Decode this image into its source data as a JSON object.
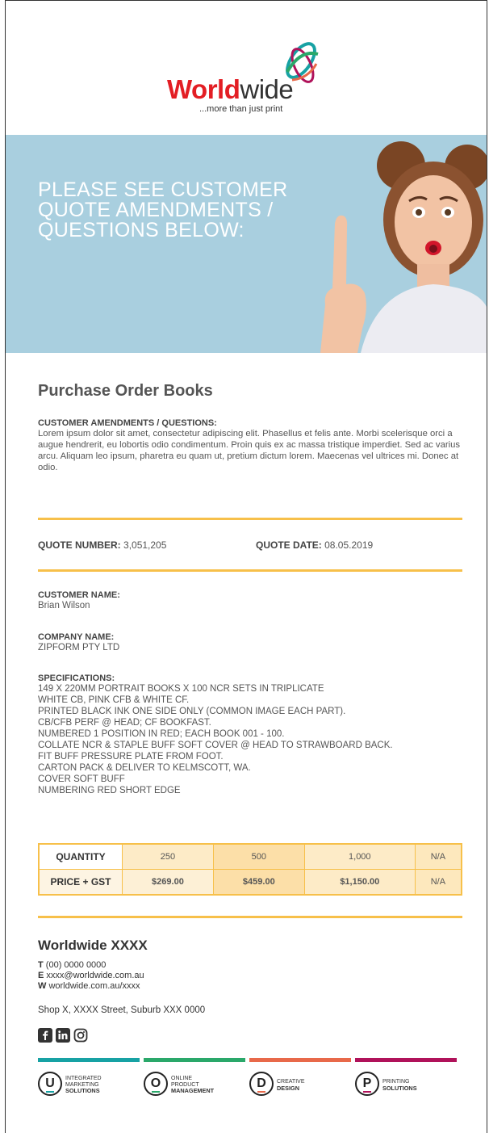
{
  "brand": {
    "name_bold": "World",
    "name_thin": "wide",
    "tagline": "...more than just print",
    "colors": {
      "red": "#e31e24",
      "teal": "#17a2a4",
      "green": "#2aa86a",
      "orange": "#e8694a",
      "magenta": "#b0125a",
      "accent_yellow": "#f7c04a",
      "hero_blue": "#a9cfdf"
    }
  },
  "hero": {
    "headline": "PLEASE SEE CUSTOMER QUOTE AMENDMENTS / QUESTIONS BELOW:"
  },
  "document": {
    "title": "Purchase Order Books",
    "amendments_label": "CUSTOMER AMENDMENTS / QUESTIONS:",
    "amendments_text": "Lorem ipsum dolor sit amet, consectetur adipiscing elit. Phasellus et felis ante. Morbi scelerisque orci a augue hendrerit, eu lobortis odio condimentum. Proin quis ex ac massa tristique imperdiet. Sed ac varius arcu. Aliquam leo ipsum, pharetra eu quam ut, pretium dictum lorem. Maecenas vel ultrices mi. Donec at odio.",
    "quote_number_label": "QUOTE NUMBER:",
    "quote_number": "3,051,205",
    "quote_date_label": "QUOTE DATE:",
    "quote_date": "08.05.2019",
    "customer_name_label": "CUSTOMER NAME:",
    "customer_name": "Brian Wilson",
    "company_name_label": "COMPANY NAME:",
    "company_name": "ZIPFORM PTY LTD",
    "specifications_label": "SPECIFICATIONS:",
    "specifications": [
      "149 x 220mm PORTRAIT BOOKS x 100 NCR SETS IN TRIPLICATE",
      "WHITE CB, PINK CFB & WHITE CF.",
      "PRINTED BLACK INK ONE SIDE ONLY (COMMON IMAGE EACH PART).",
      "CB/CFB PERF @ HEAD; CF BOOKFAST.",
      "NUMBERED 1 POSITION IN RED; EACH BOOK 001 - 100.",
      "COLLATE NCR & STAPLE BUFF SOFT COVER @ HEAD TO STRAWBOARD BACK.",
      "FIT BUFF PRESSURE PLATE FROM FOOT.",
      "CARTON PACK & DELIVER TO KELMSCOTT, WA.",
      "COVER SOFT BUFF",
      "NUMBERING RED SHORT EDGE"
    ]
  },
  "pricing": {
    "quantity_label": "QUANTITY",
    "price_label": "PRICE + GST",
    "quantities": [
      "250",
      "500",
      "1,000",
      "N/A"
    ],
    "prices": [
      "$269.00",
      "$459.00",
      "$1,150.00",
      "N/A"
    ]
  },
  "footer": {
    "company": "Worldwide XXXX",
    "phone_prefix": "T",
    "phone": "(00) 0000 0000",
    "email_prefix": "E",
    "email": "xxxx@worldwide.com.au",
    "web_prefix": "W",
    "web": "worldwide.com.au/xxxx",
    "address": "Shop X, XXXX Street, Suburb XXX 0000",
    "social_icons": [
      "facebook-icon",
      "linkedin-icon",
      "instagram-icon"
    ],
    "services": [
      {
        "letter": "U",
        "line1": "INTEGRATED",
        "line2": "MARKETING",
        "line3": "SOLUTIONS"
      },
      {
        "letter": "O",
        "line1": "ONLINE",
        "line2": "PRODUCT",
        "line3": "MANAGEMENT"
      },
      {
        "letter": "D",
        "line1": "CREATIVE",
        "line2": "DESIGN",
        "line3": ""
      },
      {
        "letter": "P",
        "line1": "PRINTING",
        "line2": "SOLUTIONS",
        "line3": ""
      }
    ]
  }
}
